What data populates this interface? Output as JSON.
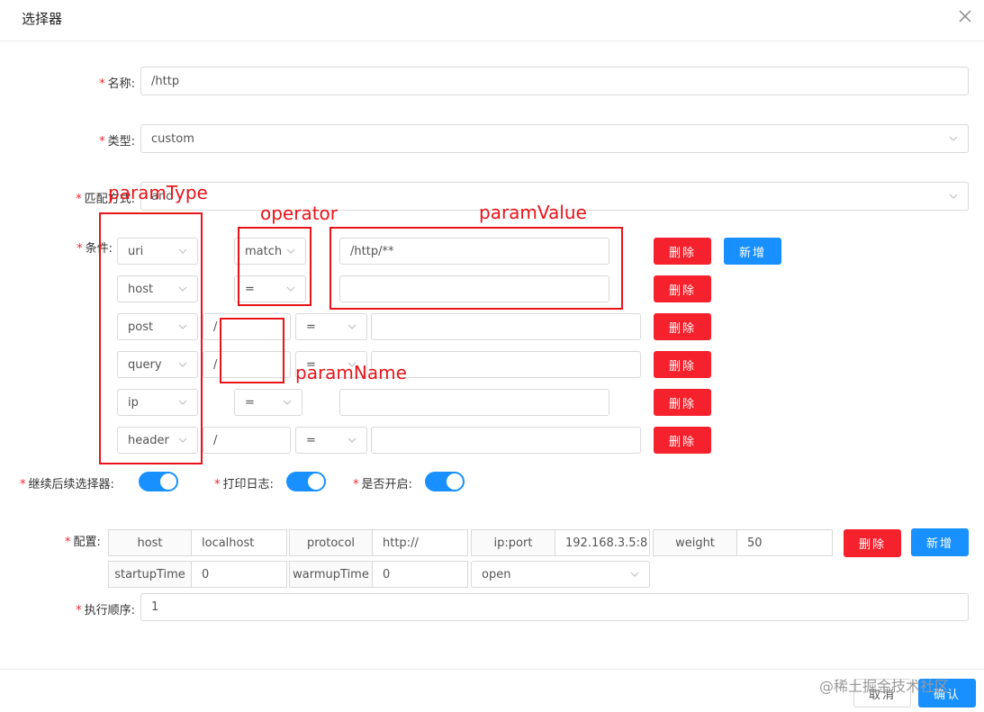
{
  "dialog": {
    "title": "选择器"
  },
  "form": {
    "name_label": "名称:",
    "name_value": "/http",
    "type_label": "类型:",
    "type_value": "custom",
    "match_label": "匹配方式:",
    "match_value": "and",
    "conditions_label": "条件:",
    "continue_label": "继续后续选择器:",
    "log_label": "打印日志:",
    "enabled_label": "是否开启:",
    "config_label": "配置:",
    "order_label": "执行顺序:",
    "order_value": "1"
  },
  "conditions": [
    {
      "paramType": "uri",
      "operator": "match",
      "paramValue": "/http/**"
    },
    {
      "paramType": "host",
      "operator": "=",
      "paramValue": ""
    },
    {
      "paramType": "post",
      "paramName": "/",
      "operator": "=",
      "paramValue": ""
    },
    {
      "paramType": "query",
      "paramName": "/",
      "operator": "=",
      "paramValue": ""
    },
    {
      "paramType": "ip",
      "operator": "=",
      "paramValue": ""
    },
    {
      "paramType": "header",
      "paramName": "/",
      "operator": "=",
      "paramValue": ""
    }
  ],
  "buttons": {
    "delete": "删除",
    "add": "新增",
    "cancel": "取消",
    "confirm": "确认"
  },
  "config": {
    "host_label": "host",
    "host_value": "localhost",
    "protocol_label": "protocol",
    "protocol_value": "http://",
    "ipport_label": "ip:port",
    "ipport_value": "192.168.3.5:8",
    "weight_label": "weight",
    "weight_value": "50",
    "startup_label": "startupTime",
    "startup_value": "0",
    "warmup_label": "warmupTime",
    "warmup_value": "0",
    "status_value": "open"
  },
  "annotations": {
    "paramType": "paramType",
    "operator": "operator",
    "paramValue": "paramValue",
    "paramName": "paramName"
  },
  "watermark": "@稀土掘金技术社区",
  "colors": {
    "primary": "#1890ff",
    "danger": "#f5222d",
    "annotation": "#e8141a"
  },
  "toggles": {
    "continue": true,
    "log": true,
    "enabled": true
  }
}
